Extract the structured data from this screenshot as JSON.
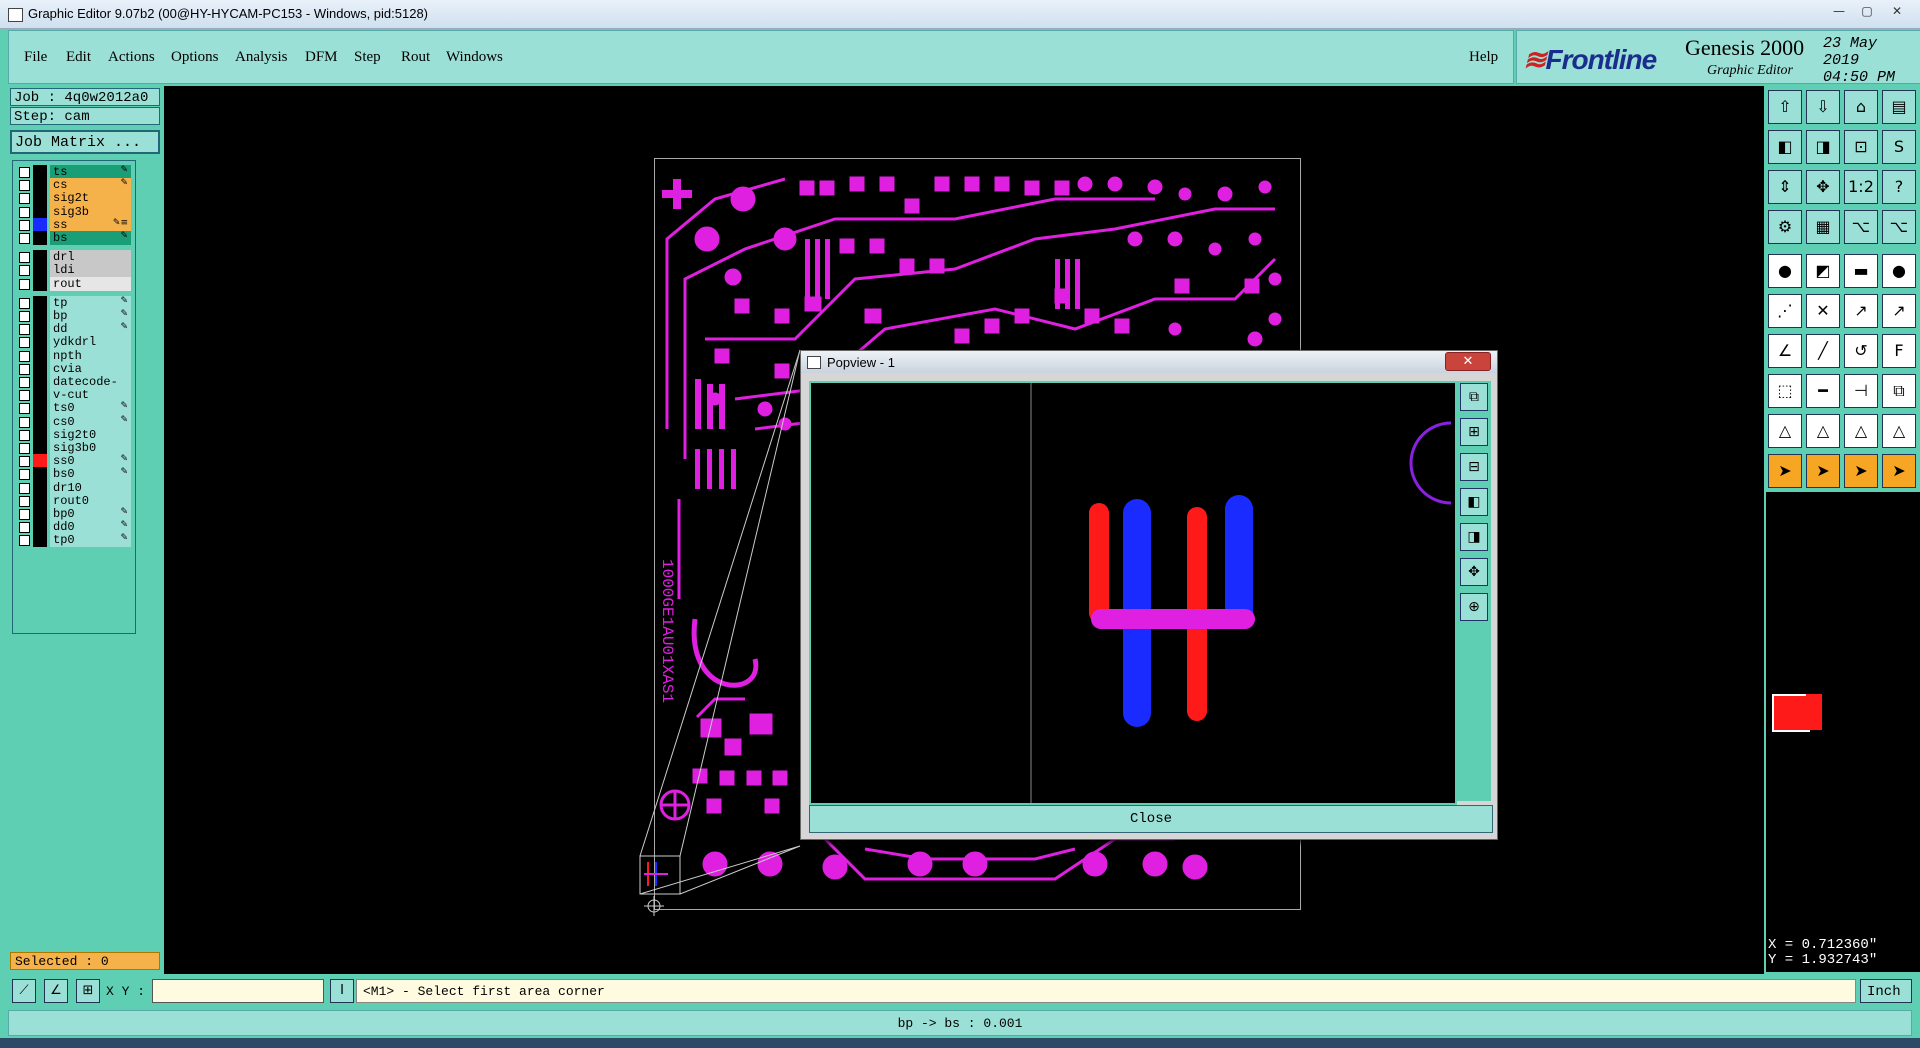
{
  "window": {
    "title": "Graphic Editor 9.07b2 (00@HY-HYCAM-PC153 - Windows, pid:5128)",
    "minimize": "—",
    "maximize": "▢",
    "close": "✕"
  },
  "menu": {
    "items": [
      "File",
      "Edit",
      "Actions",
      "Options",
      "Analysis",
      "DFM",
      "Step",
      "Rout",
      "Windows"
    ],
    "help": "Help"
  },
  "logo": {
    "brand": "Frontline",
    "product": "Genesis 2000",
    "subtitle": "Graphic Editor",
    "date": "23 May 2019",
    "time": "04:50 PM"
  },
  "job": {
    "job_label": "Job : 4q0w2012a0",
    "step_label": "Step: cam",
    "matrix_button": "Job Matrix ..."
  },
  "layers": [
    {
      "name": "ts",
      "color": "#1a9e77",
      "swatch": "#000",
      "mark": "✎"
    },
    {
      "name": "cs",
      "color": "#f6b24a",
      "swatch": "#000",
      "mark": "✎"
    },
    {
      "name": "sig2t",
      "color": "#f6b24a",
      "swatch": "#000",
      "mark": ""
    },
    {
      "name": "sig3b",
      "color": "#f6b24a",
      "swatch": "#000",
      "mark": ""
    },
    {
      "name": "ss",
      "color": "#f6b24a",
      "swatch": "#1a2bff",
      "mark": "✎≡"
    },
    {
      "name": "bs",
      "color": "#1a9e77",
      "swatch": "#000",
      "mark": "✎"
    },
    {
      "name": "drl",
      "color": "#c8c8c8",
      "swatch": "#000",
      "mark": ""
    },
    {
      "name": "ldi",
      "color": "#c8c8c8",
      "swatch": "#000",
      "mark": ""
    },
    {
      "name": "rout",
      "color": "#e6e6e6",
      "swatch": "#000",
      "mark": ""
    },
    {
      "name": "tp",
      "color": "#9be0d6",
      "swatch": "#000",
      "mark": "✎"
    },
    {
      "name": "bp",
      "color": "#9be0d6",
      "swatch": "#000",
      "mark": "✎"
    },
    {
      "name": "dd",
      "color": "#9be0d6",
      "swatch": "#000",
      "mark": "✎"
    },
    {
      "name": "ydkdrl",
      "color": "#9be0d6",
      "swatch": "#000",
      "mark": ""
    },
    {
      "name": "npth",
      "color": "#9be0d6",
      "swatch": "#000",
      "mark": ""
    },
    {
      "name": "cvia",
      "color": "#9be0d6",
      "swatch": "#000",
      "mark": ""
    },
    {
      "name": "datecode-ts",
      "color": "#9be0d6",
      "swatch": "#000",
      "mark": ""
    },
    {
      "name": "v-cut",
      "color": "#9be0d6",
      "swatch": "#000",
      "mark": ""
    },
    {
      "name": "ts0",
      "color": "#9be0d6",
      "swatch": "#000",
      "mark": "✎"
    },
    {
      "name": "cs0",
      "color": "#9be0d6",
      "swatch": "#000",
      "mark": "✎"
    },
    {
      "name": "sig2t0",
      "color": "#9be0d6",
      "swatch": "#000",
      "mark": ""
    },
    {
      "name": "sig3b0",
      "color": "#9be0d6",
      "swatch": "#000",
      "mark": ""
    },
    {
      "name": "ss0",
      "color": "#9be0d6",
      "swatch": "#ff1a1a",
      "mark": "✎"
    },
    {
      "name": "bs0",
      "color": "#9be0d6",
      "swatch": "#000",
      "mark": "✎"
    },
    {
      "name": "dr10",
      "color": "#9be0d6",
      "swatch": "#000",
      "mark": ""
    },
    {
      "name": "rout0",
      "color": "#9be0d6",
      "swatch": "#000",
      "mark": ""
    },
    {
      "name": "bp0",
      "color": "#9be0d6",
      "swatch": "#000",
      "mark": "✎"
    },
    {
      "name": "dd0",
      "color": "#9be0d6",
      "swatch": "#000",
      "mark": "✎"
    },
    {
      "name": "tp0",
      "color": "#9be0d6",
      "swatch": "#000",
      "mark": "✎"
    }
  ],
  "selected": "Selected : 0",
  "popview": {
    "title": "Popview - 1",
    "close_button": "Close"
  },
  "board_text": "1000GE1AU01XAS1",
  "coords": {
    "x": "X = 0.712360\"",
    "y": "Y = 1.932743\""
  },
  "command": {
    "xy_label": "X Y :",
    "xy_value": "",
    "prompt": "<M1> - Select first area corner",
    "units": "Inch"
  },
  "status": "bp -> bs : 0.001",
  "colors": {
    "panel": "#5fcfb3",
    "light_panel": "#9be0d6",
    "trace": "#e020e0",
    "red": "#ff1a1a",
    "blue": "#1a2bff"
  }
}
